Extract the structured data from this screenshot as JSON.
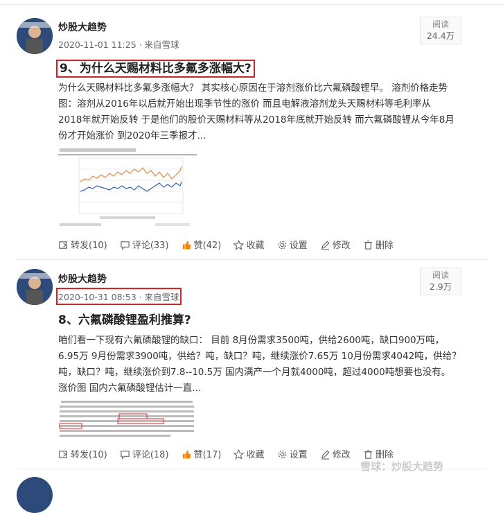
{
  "posts": [
    {
      "author": "炒股大趋势",
      "meta": "2020-11-01 11:25 · 来自雪球",
      "read_label": "阅读",
      "read_count": "24.4万",
      "title": "9、为什么天赐材料比多氟多涨幅大?",
      "body_lines": [
        "为什么天赐材料比多氟多涨幅大？ 其实核心原因在于溶剂涨价比六氟磷酸锂早。 溶剂价格走势",
        "图：溶剂从2016年以后就开始出现季节性的涨价 而且电解液溶剂龙头天赐材料等毛利率从",
        "2018年就开始反转 于是他们的股价天赐材料等从2018年底就开始反转 而六氟磷酸锂从今年8月",
        "份才开始涨价 到2020年三季报才..."
      ],
      "actions": {
        "repost": "转发(10)",
        "comment": "评论(33)",
        "like": "赞(42)",
        "favorite": "收藏",
        "settings": "设置",
        "edit": "修改",
        "delete": "删除"
      }
    },
    {
      "author": "炒股大趋势",
      "meta": "2020-10-31 08:53 · 来自雪球",
      "read_label": "阅读",
      "read_count": "2.9万",
      "title": "8、六氟磷酸锂盈利推算?",
      "body_lines": [
        "咱们看一下现有六氟磷酸锂的缺口： 目前 8月份需求3500吨，供给2600吨，缺口900万吨，",
        "6.95万 9月份需求3900吨，供给？吨，缺口？吨，继续涨价7.65万 10月份需求4042吨，供给？",
        "吨，缺口？吨，继续涨价到7.8--10.5万 国内满产一个月就4000吨，超过4000吨想要也没有。",
        "涨价图 国内六氟磷酸锂估计一直..."
      ],
      "actions": {
        "repost": "转发(10)",
        "comment": "评论(18)",
        "like": "赞(17)",
        "favorite": "收藏",
        "settings": "设置",
        "edit": "修改",
        "delete": "删除"
      }
    }
  ],
  "watermark": "雪球：炒股大趋势",
  "colors": {
    "highlight_border": "#e02020",
    "like_icon": "#ff7f00",
    "chart_orange": "#e8873a",
    "chart_blue": "#2e62b8"
  }
}
